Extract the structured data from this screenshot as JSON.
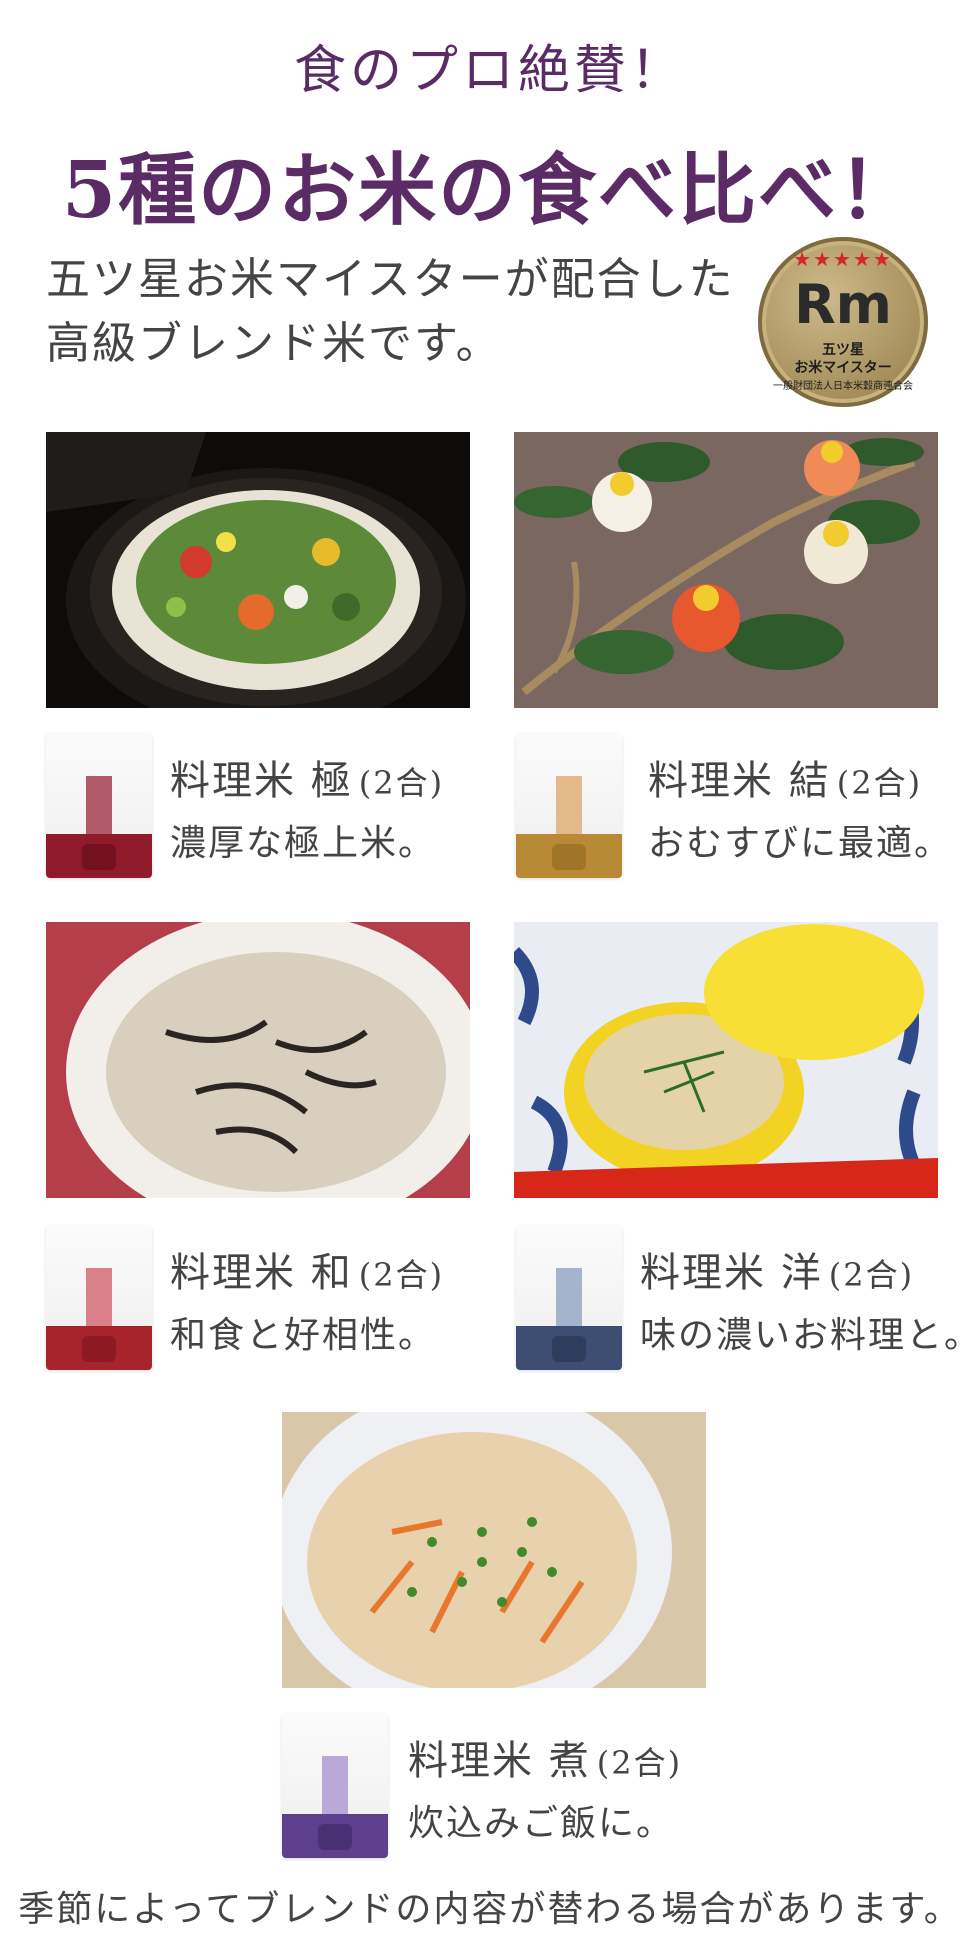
{
  "header": {
    "title_small": "食のプロ絶賛！",
    "title_large": "5種のお米の食べ比べ！",
    "intro_line1": "五ツ星お米マイスターが配合した",
    "intro_line2": "高級ブレンド米です。"
  },
  "badge": {
    "stars": "★★★★★",
    "logo": "Rm",
    "line1": "五ツ星",
    "line2": "お米マイスター",
    "ring": "一般財団法人日本米穀商連合会"
  },
  "products": [
    {
      "name": "料理米 極",
      "size": "(2合)",
      "desc": "濃厚な極上米。",
      "color": "#8e1a2a"
    },
    {
      "name": "料理米 結",
      "size": "(2合)",
      "desc": "おむすびに最適。",
      "color": "#b88a36"
    },
    {
      "name": "料理米 和",
      "size": "(2合)",
      "desc": "和食と好相性。",
      "color": "#a8242d"
    },
    {
      "name": "料理米 洋",
      "size": "(2合)",
      "desc": "味の濃いお料理と。",
      "color": "#3e4d72"
    },
    {
      "name": "料理米 煮",
      "size": "(2合)",
      "desc": "炊込みご飯に。",
      "color": "#5d3f8e"
    }
  ],
  "footer": {
    "note": "季節によってブレンドの内容が替わる場合があります。"
  }
}
